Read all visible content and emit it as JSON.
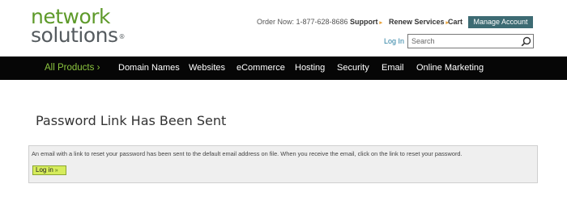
{
  "logo": {
    "line1": "network",
    "line2": "solutions",
    "reg": "®"
  },
  "header": {
    "order_text": "Order Now: 1-877-628-8686",
    "support": "Support",
    "renew": "Renew Services",
    "cart": "Cart",
    "manage_account": "Manage Account",
    "login_link": "Log In",
    "search_placeholder": "Search"
  },
  "nav": {
    "items": [
      {
        "label": "All Products",
        "arrow": "›"
      },
      {
        "label": "Domain Names"
      },
      {
        "label": "Websites"
      },
      {
        "label": "eCommerce"
      },
      {
        "label": "Hosting"
      },
      {
        "label": "Security"
      },
      {
        "label": "Email"
      },
      {
        "label": "Online Marketing"
      }
    ]
  },
  "main": {
    "title": "Password Link Has Been Sent",
    "notice": "An email with a link to reset your password has been sent to the default email address on file. When you receive the email, click on the link to reset your password.",
    "login_button": "Log in"
  },
  "colors": {
    "brand_green": "#5e9a2a",
    "nav_active": "#8cc63f",
    "manage_btn": "#3d6b73",
    "nav_bg": "#060606",
    "link_blue": "#2a7fa2",
    "login_btn_bg": "#d6ec5c"
  },
  "icons": {
    "search": "search-icon",
    "utility_arrow": "triangle-right-icon"
  }
}
